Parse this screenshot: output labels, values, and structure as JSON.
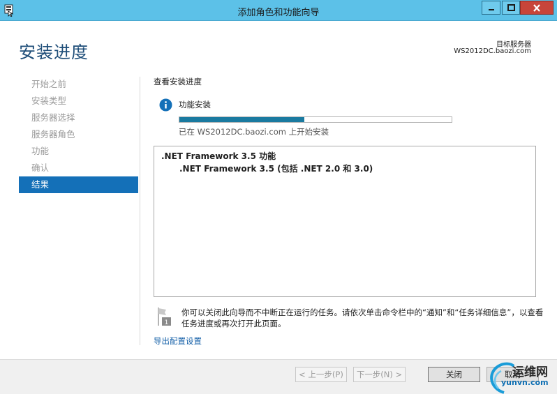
{
  "window": {
    "title": "添加角色和功能向导",
    "minimize_icon": "minimize-icon",
    "maximize_icon": "maximize-icon",
    "close_icon": "close-icon"
  },
  "header": {
    "title": "安装进度",
    "target_label": "目标服务器",
    "target_server": "WS2012DC.baozi.com"
  },
  "nav": {
    "items": [
      {
        "label": "开始之前",
        "active": false
      },
      {
        "label": "安装类型",
        "active": false
      },
      {
        "label": "服务器选择",
        "active": false
      },
      {
        "label": "服务器角色",
        "active": false
      },
      {
        "label": "功能",
        "active": false
      },
      {
        "label": "确认",
        "active": false
      },
      {
        "label": "结果",
        "active": true
      }
    ]
  },
  "content": {
    "section_title": "查看安装进度",
    "install_label": "功能安装",
    "progress_percent": 46,
    "status_text": "已在 WS2012DC.baozi.com 上开始安装",
    "results": [
      {
        "feature": ".NET Framework 3.5 功能",
        "sub": ".NET Framework 3.5 (包括 .NET 2.0 和 3.0)"
      }
    ],
    "note_text": "你可以关闭此向导而不中断正在运行的任务。请依次单击命令栏中的“通知”和“任务详细信息”，以查看任务进度或再次打开此页面。",
    "note_badge": "1",
    "export_link": "导出配置设置"
  },
  "footer": {
    "prev_label": "< 上一步(P)",
    "next_label": "下一步(N) >",
    "close_label": "关闭",
    "cancel_label": "取消"
  },
  "watermark": {
    "cn": "运维网",
    "url": "yunvn.com"
  },
  "colors": {
    "titlebar": "#5cc1e8",
    "accent": "#1470b8",
    "close_button": "#c7453a",
    "progress_fill": "#1a7aa0"
  }
}
